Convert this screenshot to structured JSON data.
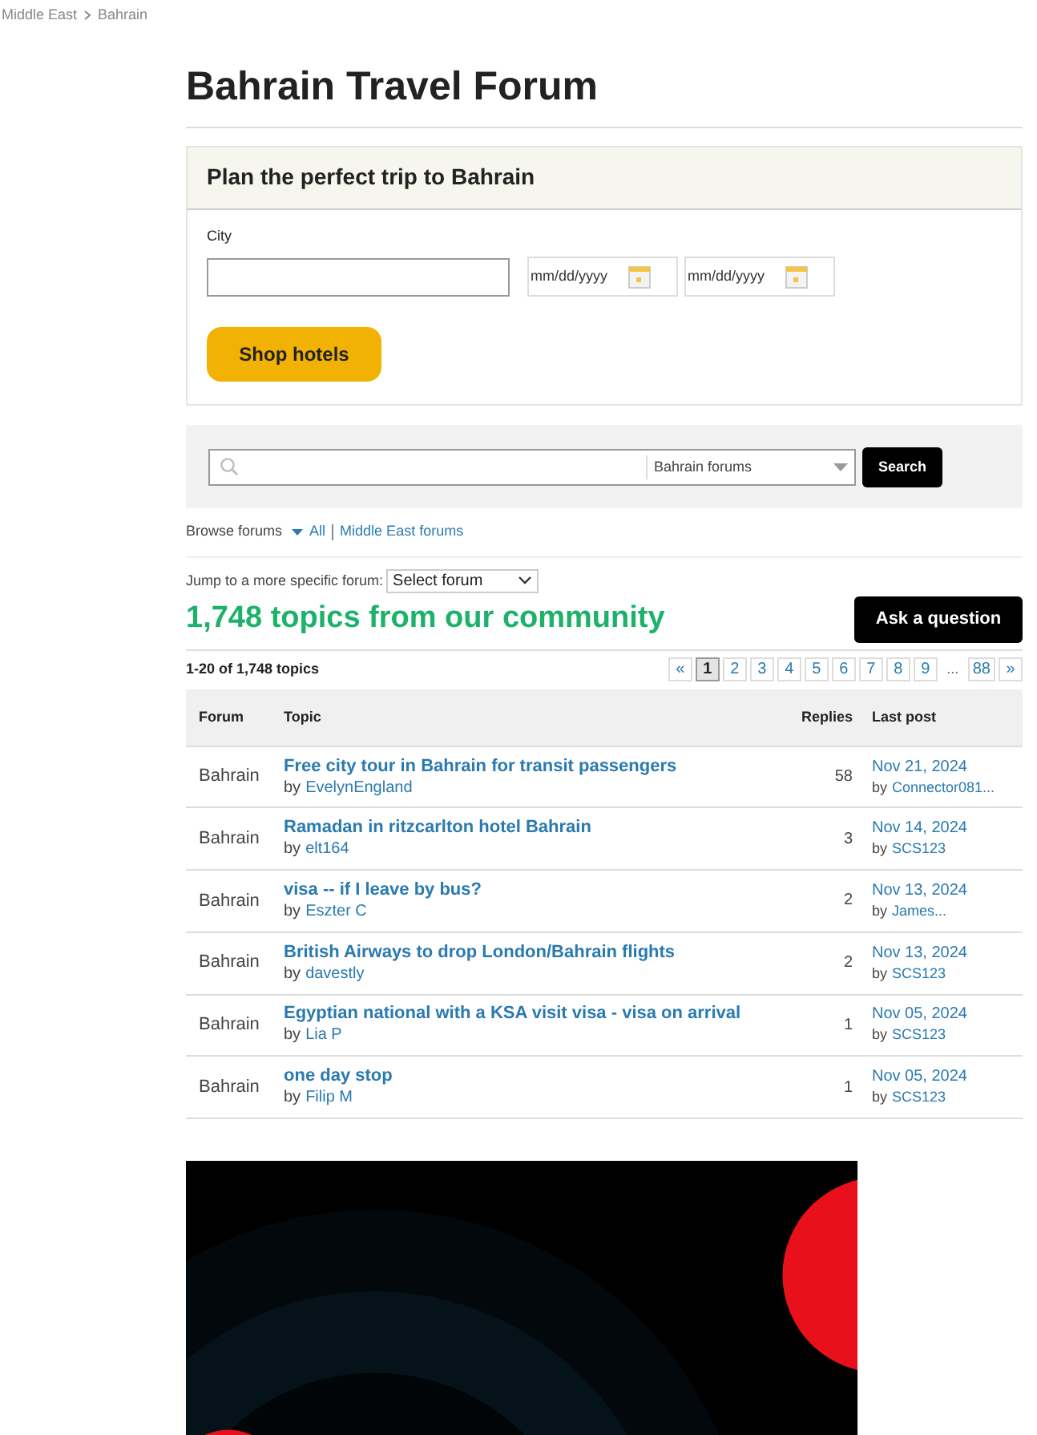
{
  "breadcrumb": [
    "Middle East",
    "Bahrain"
  ],
  "title": "Bahrain Travel Forum",
  "planner": {
    "heading": "Plan the perfect trip to Bahrain",
    "city_label": "City",
    "date_placeholders": [
      "mm/dd/yyyy",
      "mm/dd/yyyy"
    ],
    "button": "Shop hotels"
  },
  "search": {
    "scope": "Bahrain forums",
    "button": "Search"
  },
  "browse": {
    "label": "Browse forums",
    "links": [
      "All",
      "Middle East forums"
    ]
  },
  "jump": {
    "label": "Jump to a more specific forum:",
    "select": "Select forum"
  },
  "headline": "1,748 topics from our community",
  "ask_button": "Ask a question",
  "count": "1-20 of 1,748 topics",
  "pagination": [
    {
      "label": "«",
      "selected": false
    },
    {
      "label": "1",
      "selected": true
    },
    {
      "label": "2",
      "selected": false
    },
    {
      "label": "3",
      "selected": false
    },
    {
      "label": "4",
      "selected": false
    },
    {
      "label": "5",
      "selected": false
    },
    {
      "label": "6",
      "selected": false
    },
    {
      "label": "7",
      "selected": false
    },
    {
      "label": "8",
      "selected": false
    },
    {
      "label": "9",
      "selected": false
    },
    {
      "label": "...",
      "kind": "gap"
    },
    {
      "label": "88",
      "selected": false
    },
    {
      "label": "»",
      "selected": false
    }
  ],
  "table": {
    "columns": [
      "Forum",
      "Topic",
      "Replies",
      "Last post"
    ],
    "rows": [
      {
        "forum": "Bahrain",
        "topic": "Free city tour in Bahrain for transit passengers",
        "by": "by",
        "author": "EvelynEngland",
        "replies": "58",
        "date": "Nov 21, 2024",
        "last_by": "by",
        "last_author": "Connector081..."
      },
      {
        "forum": "Bahrain",
        "topic": "Ramadan in ritzcarlton hotel Bahrain",
        "by": "by",
        "author": "elt164",
        "replies": "3",
        "date": "Nov 14, 2024",
        "last_by": "by",
        "last_author": "SCS123"
      },
      {
        "forum": "Bahrain",
        "topic": "visa -- if I leave by bus?",
        "by": "by",
        "author": "Eszter C",
        "replies": "2",
        "date": "Nov 13, 2024",
        "last_by": "by",
        "last_author": "James..."
      },
      {
        "forum": "Bahrain",
        "topic": "British Airways to drop London/Bahrain flights",
        "by": "by",
        "author": "davestly",
        "replies": "2",
        "date": "Nov 13, 2024",
        "last_by": "by",
        "last_author": "SCS123"
      },
      {
        "forum": "Bahrain",
        "topic": "Egyptian national with a KSA visit visa - visa on arrival",
        "by": "by",
        "author": "Lia P",
        "replies": "1",
        "date": "Nov 05, 2024",
        "last_by": "by",
        "last_author": "SCS123"
      },
      {
        "forum": "Bahrain",
        "topic": "one day stop",
        "by": "by",
        "author": "Filip M",
        "replies": "1",
        "date": "Nov 05, 2024",
        "last_by": "by",
        "last_author": "SCS123"
      }
    ]
  }
}
